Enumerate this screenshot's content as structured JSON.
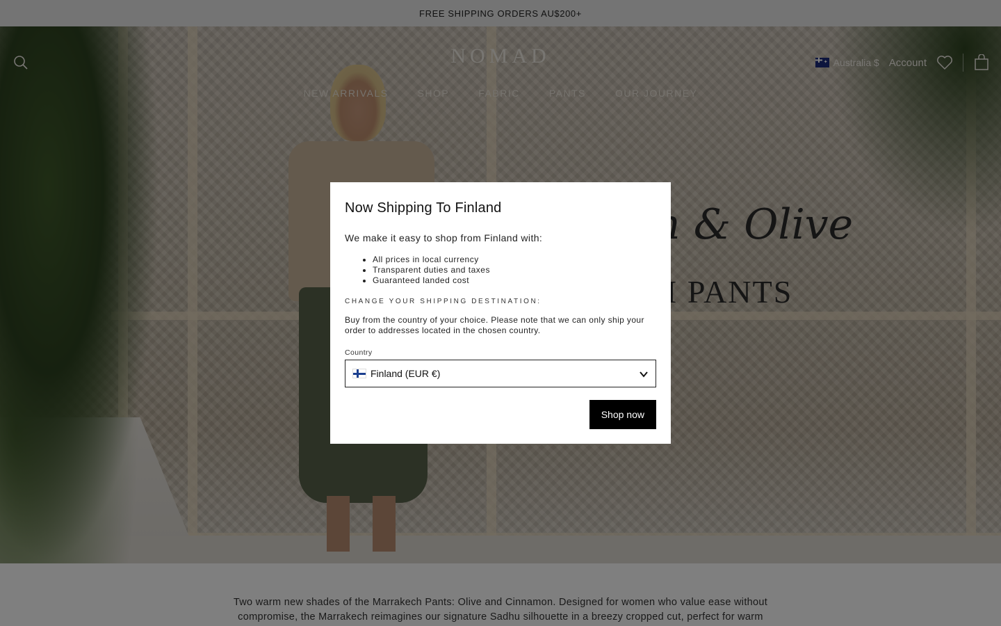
{
  "announcement": {
    "text": "FREE SHIPPING ORDERS AU$200+"
  },
  "header": {
    "logo": "NOMAD",
    "currency": {
      "country": "Australia",
      "symbol": "$",
      "label": "Australia $"
    },
    "account_label": "Account",
    "icons": [
      "search-icon",
      "heart-icon",
      "shopping-bag-icon"
    ]
  },
  "nav": {
    "items": [
      {
        "label": "NEW ARRIVALS"
      },
      {
        "label": "SHOP"
      },
      {
        "label": "FABRIC"
      },
      {
        "label": "PANTS"
      },
      {
        "label": "OUR JOURNEY"
      }
    ]
  },
  "hero": {
    "script_text": "n & Olive",
    "headline": "I PANTS"
  },
  "modal": {
    "title": "Now Shipping To Finland",
    "intro": "We make it easy to shop from Finland with:",
    "benefits": [
      "All prices in local currency",
      "Transparent duties and taxes",
      "Guaranteed landed cost"
    ],
    "change_heading": "Change your shipping destination:",
    "note": "Buy from the country of your choice. Please note that we can only ship your order to addresses located in the chosen country.",
    "country_label": "Country",
    "country_value": "Finland (EUR €)",
    "cta": "Shop now"
  },
  "below": {
    "paragraph": "Two warm new shades of the Marrakech Pants: Olive and Cinnamon. Designed for women who value ease without compromise, the Marrakech reimagines our signature Sadhu silhouette in a breezy cropped cut, perfect for warm"
  },
  "colors": {
    "overlay": "rgba(0,0,0,0.5)",
    "button": "#000000",
    "announcement_bg": "#e9e9e9"
  }
}
